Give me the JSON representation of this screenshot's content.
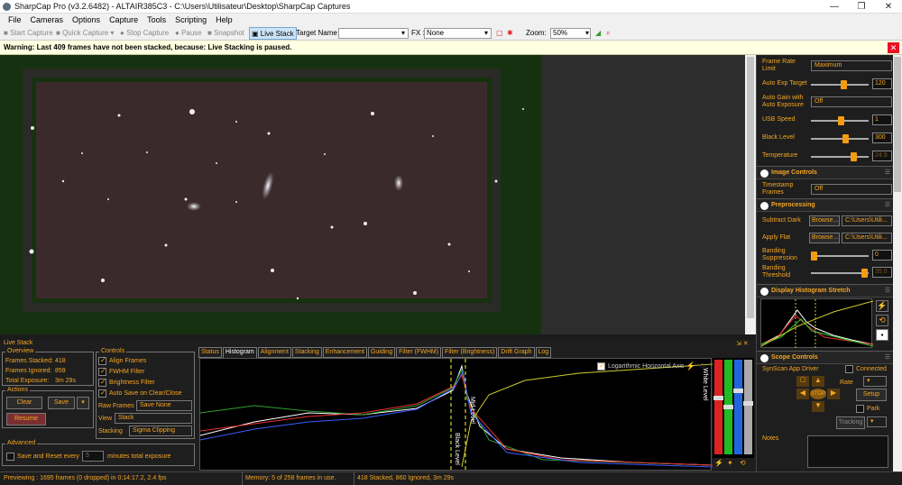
{
  "window": {
    "title": "SharpCap Pro (v3.2.6482) - ALTAIR385C3 - C:\\Users\\Utilisateur\\Desktop\\SharpCap Captures",
    "minimize": "—",
    "maximize": "❐",
    "close": "✕"
  },
  "menu": [
    "File",
    "Cameras",
    "Options",
    "Capture",
    "Tools",
    "Scripting",
    "Help"
  ],
  "toolbar": {
    "start_capture": "Start Capture",
    "quick_capture": "Quick Capture",
    "stop_capture": "Stop Capture",
    "pause": "Pause",
    "snapshot": "Snapshot",
    "live_stack": "Live Stack",
    "target_name_label": "Target Name :",
    "target_name_value": "",
    "fx_label": "FX :",
    "fx_value": "None",
    "zoom_label": "Zoom:",
    "zoom_value": "50%"
  },
  "warning": {
    "text": "Warning: Last 409 frames have not been stacked, because: Live Stacking is paused.",
    "close": "✕"
  },
  "right_panel": {
    "frame_rate_limit": {
      "label": "Frame Rate Limit",
      "value": "Maximum"
    },
    "auto_exp_target": {
      "label": "Auto Exp Target",
      "value": "120",
      "level": 0.55
    },
    "auto_gain": {
      "label": "Auto Gain with Auto Exposure",
      "value": "Off"
    },
    "usb_speed": {
      "label": "USB Speed",
      "value": "1",
      "level": 0.5
    },
    "black_level": {
      "label": "Black Level",
      "value": "300",
      "level": 0.58
    },
    "temperature": {
      "label": "Temperature",
      "value": "24.9",
      "level": 0.7
    },
    "image_controls": {
      "title": "Image Controls"
    },
    "timestamp_frames": {
      "label": "Timestamp Frames",
      "value": "Off"
    },
    "preprocessing": {
      "title": "Preprocessing"
    },
    "subtract_dark": {
      "label": "Subtract Dark",
      "button": "Browse...",
      "value": "C:\\Users\\Utili..."
    },
    "apply_flat": {
      "label": "Apply Flat",
      "button": "Browse...",
      "value": "C:\\Users\\Utili..."
    },
    "banding_suppression": {
      "label": "Banding Suppression",
      "value": "0",
      "level": 0.0
    },
    "banding_threshold": {
      "label": "Banding Threshold",
      "value": "35.0",
      "level": 0.9
    },
    "display_histogram": {
      "title": "Display Histogram Stretch"
    },
    "scope_controls": {
      "title": "Scope Controls"
    },
    "scope_driver": "SynScan App Driver",
    "connected_label": "Connected",
    "rate_label": "Rate",
    "setup_button": "Setup",
    "park_label": "Park",
    "tracking_label": "Tracking",
    "stop_label": "STOP",
    "notes_label": "Notes"
  },
  "live_stack": {
    "title": "Live Stack",
    "dock_icons": "⇲ ✕",
    "overview_title": "Overview",
    "frames_stacked_label": "Frames Stacked:",
    "frames_stacked": "418",
    "frames_ignored_label": "Frames Ignored:",
    "frames_ignored": "859",
    "total_exposure_label": "Total Exposure:",
    "total_exposure": "3m 29s",
    "actions_title": "Actions",
    "clear": "Clear",
    "save": "Save",
    "resume": "Resume",
    "advanced_title": "Advanced",
    "save_reset_label": "Save and Reset every",
    "save_reset_value": "5",
    "save_reset_suffix": "minutes total exposure",
    "controls_title": "Controls",
    "align_frames": "Align Frames",
    "fwhm_filter": "FWHM Filter",
    "brightness_filter": "Brightness Filter",
    "auto_save": "Auto Save on Clear/Close",
    "raw_frames_label": "Raw Frames",
    "raw_frames_value": "Save None",
    "view_label": "View",
    "view_value": "Stack",
    "stacking_label": "Stacking",
    "stacking_value": "Sigma Clipping"
  },
  "tabs": [
    "Status",
    "Histogram",
    "Alignment",
    "Stacking",
    "Enhancement",
    "Guiding",
    "Filter (FWHM)",
    "Filter (Brightness)",
    "Drift Graph",
    "Log"
  ],
  "histogram": {
    "log_axis_label": "Logarithmic Horizontal Axis",
    "black_level": "Black Level",
    "mid_level": "Mid Level",
    "white_level": "White Level"
  },
  "status": {
    "previewing": "Previewing : 1695 frames (0 dropped) in 0:14:17.2, 2.4 fps",
    "memory": "Memory: 5 of 258 frames in use.",
    "stacked": "418 Stacked, 860 Ignored, 3m 29s"
  }
}
